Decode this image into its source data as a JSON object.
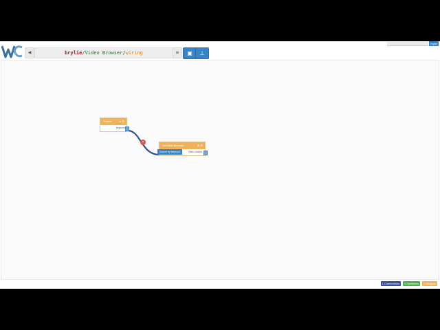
{
  "header": {
    "breadcrumb": {
      "user": "brylie",
      "workspace": "Video Browser",
      "view": "wiring",
      "separator": "/"
    },
    "back_icon": "chevron-left-icon",
    "menu_icon": "menu-icon",
    "toolbar": [
      {
        "name": "components-button",
        "icon": "components-icon"
      },
      {
        "name": "layout-button",
        "icon": "sitemap-icon"
      }
    ],
    "user_badge": "brylie"
  },
  "nodes": [
    {
      "title": "Search",
      "actions": "✏ ⚙",
      "outputs": [
        {
          "label": "keyword"
        }
      ]
    },
    {
      "title": "YouTube Browser",
      "actions": "☰ ⚙",
      "inputs": [
        {
          "label": "Search by keyword"
        }
      ],
      "outputs": [
        {
          "label": "Video clicked"
        }
      ]
    }
  ],
  "connection": {
    "remove_icon": "×"
  },
  "status": {
    "connections": "1 Connections",
    "operators": "0 Operators",
    "widgets": "2 Widgets"
  },
  "colors": {
    "accent": "#3a84c6",
    "widget": "#efb25a",
    "wire": "#2e4f8a",
    "connections_badge": "#3a4f9c",
    "operators_badge": "#4cae4c",
    "widgets_badge": "#efb25a"
  }
}
